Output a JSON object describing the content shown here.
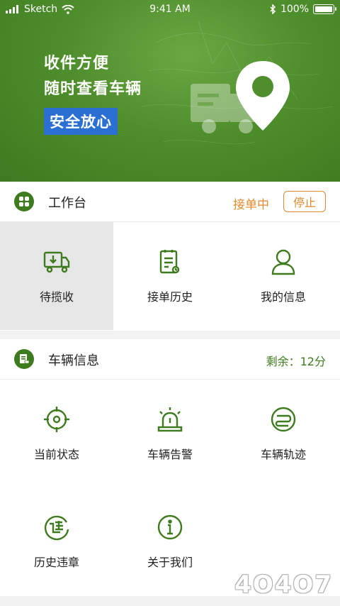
{
  "status_bar": {
    "carrier": "Sketch",
    "time": "9:41 AM",
    "battery": "100%"
  },
  "hero": {
    "line1": "收件方便",
    "line2": "随时查看车辆",
    "badge": "安全放心"
  },
  "workbench": {
    "title": "工作台",
    "status": "接单中",
    "stop_label": "停止",
    "items": [
      {
        "label": "待揽收",
        "icon": "truck-download-icon"
      },
      {
        "label": "接单历史",
        "icon": "clipboard-history-icon"
      },
      {
        "label": "我的信息",
        "icon": "user-icon"
      }
    ]
  },
  "vehicle": {
    "title": "车辆信息",
    "remaining": "剩余：12分",
    "items": [
      {
        "label": "当前状态",
        "icon": "target-icon"
      },
      {
        "label": "车辆告警",
        "icon": "alarm-light-icon"
      },
      {
        "label": "车辆轨迹",
        "icon": "route-icon"
      },
      {
        "label": "历史违章",
        "icon": "violation-icon"
      },
      {
        "label": "关于我们",
        "icon": "info-icon"
      }
    ]
  },
  "watermark": "4O4O7",
  "colors": {
    "primary": "#3e7b1f",
    "accent": "#e08a2e",
    "badge": "#2b6fd3"
  }
}
